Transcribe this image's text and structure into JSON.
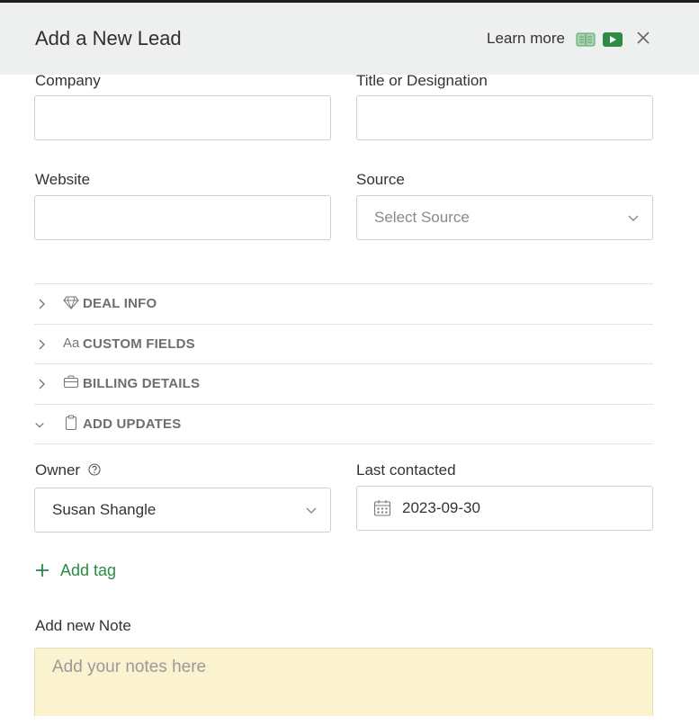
{
  "header": {
    "title": "Add a New Lead",
    "learn_more": "Learn more",
    "book_icon": "book-icon",
    "video_icon": "video-icon",
    "close_icon": "close-icon"
  },
  "fields": {
    "company_label": "Company",
    "title_label": "Title or Designation",
    "website_label": "Website",
    "source_label": "Source",
    "source_placeholder": "Select Source"
  },
  "sections": [
    {
      "label": "DEAL INFO",
      "icon": "diamond-icon",
      "expanded": false
    },
    {
      "label": "CUSTOM FIELDS",
      "icon": "aa-icon",
      "icon_text": "Aa",
      "expanded": false
    },
    {
      "label": "BILLING DETAILS",
      "icon": "briefcase-icon",
      "expanded": false
    },
    {
      "label": "ADD UPDATES",
      "icon": "clipboard-icon",
      "expanded": true
    }
  ],
  "updates": {
    "owner_label": "Owner",
    "owner_value": "Susan Shangle",
    "last_contacted_label": "Last contacted",
    "last_contacted_value": "2023-09-30",
    "add_tag_label": "Add tag",
    "note_label": "Add new Note",
    "note_placeholder": "Add your notes here"
  },
  "colors": {
    "header_bg": "#eef0ef",
    "accent_green": "#2e8a45",
    "note_bg": "#fbf2cf"
  }
}
